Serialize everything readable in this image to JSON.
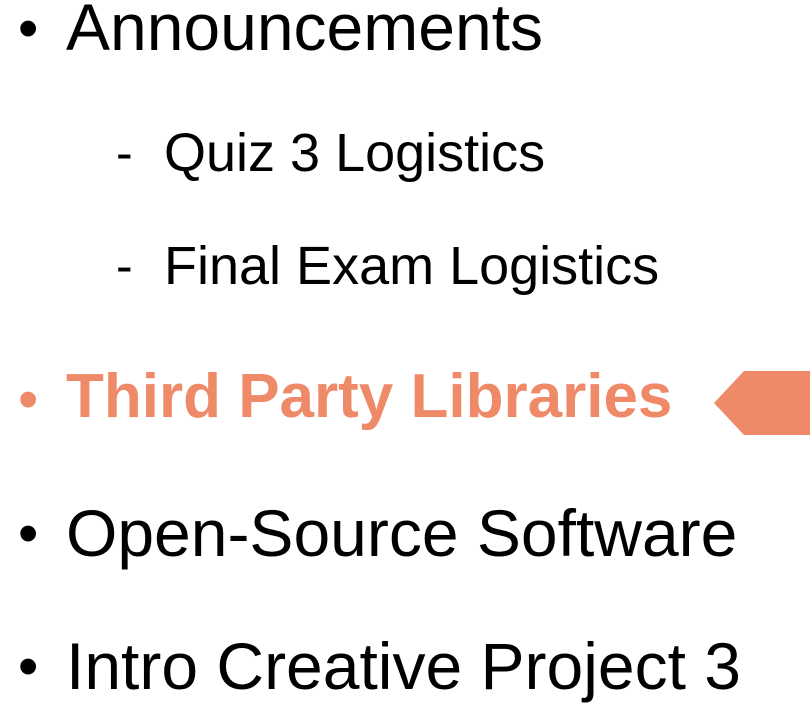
{
  "agenda": {
    "items": [
      {
        "bullet": "•",
        "label": "Announcements"
      },
      {
        "bullet": "•",
        "label": "Third Party Libraries"
      },
      {
        "bullet": "•",
        "label": "Open-Source Software"
      },
      {
        "bullet": "•",
        "label": "Intro Creative Project 3"
      }
    ],
    "subitems": [
      {
        "marker": "-",
        "label": "Quiz 3 Logistics"
      },
      {
        "marker": "-",
        "label": "Final Exam Logistics"
      }
    ]
  },
  "colors": {
    "highlight": "#ef8a68",
    "text": "#000000",
    "background": "#ffffff"
  },
  "current_item_marker": {
    "icon": "pointer-arrow-icon",
    "direction": "left"
  }
}
